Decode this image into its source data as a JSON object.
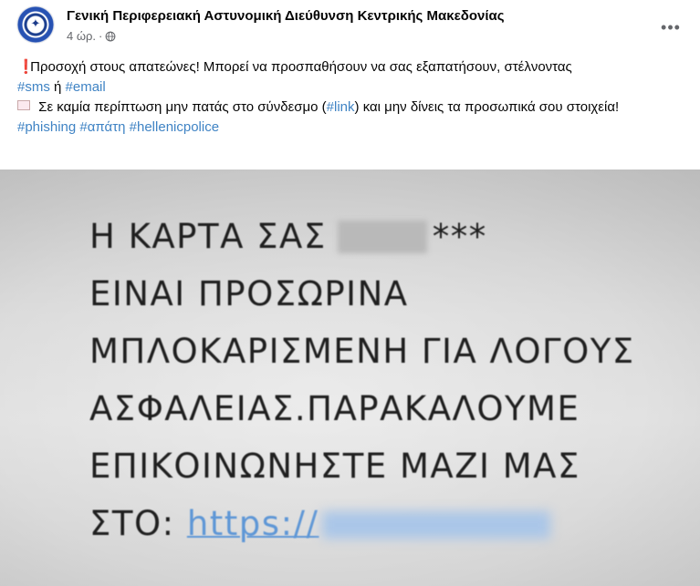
{
  "post": {
    "page_name": "Γενική Περιφερειακή Αστυνομική Διεύθυνση Κεντρικής Μακεδονίας",
    "time": "4 ώρ.",
    "separator": "·",
    "more_icon": "more-horizontal-icon",
    "privacy_icon": "globe-icon",
    "avatar_icon": "police-logo",
    "text": {
      "line1_prefix": "Προσοχή στους απατεώνες! Μπορεί να προσπαθήσουν να σας εξαπατήσουν, στέλνοντας",
      "line1_emoji": "❗",
      "hashtag_sms": "#sms",
      "conj": "ή",
      "hashtag_email": "#email",
      "line2_prefix": "Σε καμία περίπτωση μην πατάς στο σύνδεσμο (",
      "hashtag_link": "#link",
      "line2_suffix": ") και μην δίνεις τα προσωπικά σου στοιχεία!",
      "line2_emoji": "envelope-icon",
      "tags": [
        "#phishing",
        "#απάτη",
        "#hellenicpolice"
      ]
    }
  },
  "image": {
    "lines": [
      "Η ΚΑΡΤΑ ΣΑΣ",
      "***",
      "ΕΙΝΑΙ ΠΡΟΣΩΡΙΝΑ",
      "ΜΠΛΟΚΑΡΙΣΜΕΝΗ ΓΙΑ ΛΟΓΟΥΣ",
      "ΑΣΦΑΛΕΙΑΣ.ΠΑΡΑΚΑΛΟΥΜΕ",
      "ΕΠΙΚΟΙΝΩΝΗΣΤΕ ΜΑΖΙ ΜΑΣ",
      "ΣΤΟ:",
      "https://"
    ]
  },
  "colors": {
    "hashtag": "#3f83c4",
    "meta": "#65676b",
    "link_in_image": "#5f97d6"
  }
}
